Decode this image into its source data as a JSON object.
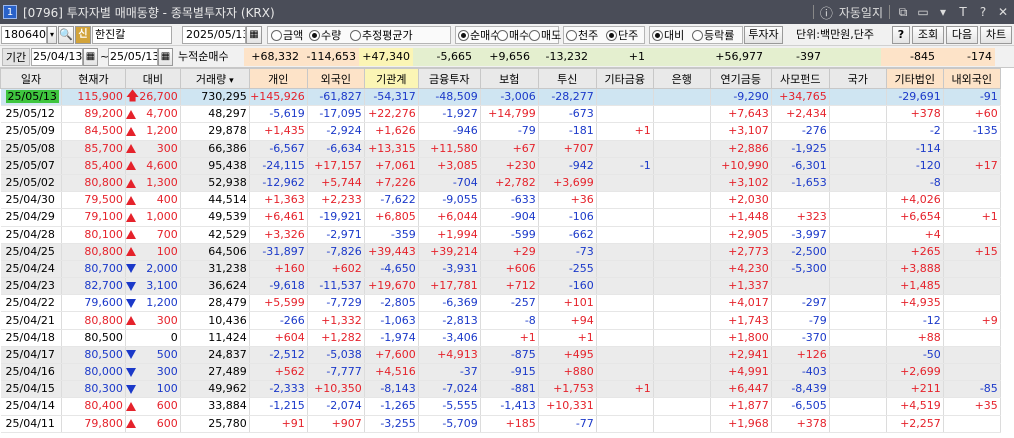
{
  "window": {
    "badge": "1",
    "screen_no": "[0796]",
    "title": "투자자별 매매동향 - 종목별투자자 (KRX)",
    "auto_lock": "자동일지",
    "icons": [
      "pin-icon",
      "layout-icon",
      "text-icon",
      "text-small-icon",
      "question-icon",
      "close-icon"
    ]
  },
  "toolbar": {
    "code": "180640",
    "stock_badge": "신",
    "stock_name": "한진칼",
    "date": "2025/05/13",
    "amount_opts": [
      {
        "label": "금액",
        "on": false
      },
      {
        "label": "수량",
        "on": true
      },
      {
        "label": "추정평균가",
        "on": false
      }
    ],
    "trade_opts": [
      {
        "label": "순매수",
        "on": true
      },
      {
        "label": "매수",
        "on": false
      },
      {
        "label": "매도",
        "on": false
      }
    ],
    "unit_opts": [
      {
        "label": "천주",
        "on": false
      },
      {
        "label": "단주",
        "on": true
      }
    ],
    "compare_opts": [
      {
        "label": "대비",
        "on": true
      },
      {
        "label": "등락률",
        "on": false
      }
    ],
    "investor_btn": "투자자",
    "unit_text": "단위:백만원,단주",
    "help_btn": "?",
    "query_btn": "조회",
    "next_btn": "다음",
    "chart_btn": "차트"
  },
  "period": {
    "label": "기간",
    "from": "25/04/13",
    "sep": "~",
    "to": "25/05/13",
    "cum_label": "누적순매수"
  },
  "sums": {
    "개인": "+68,332",
    "외국인": "-114,653",
    "기관계": "+47,340",
    "금융투자": "-5,665",
    "보험": "+9,656",
    "투신": "-13,232",
    "기타금융": "+1",
    "은행": "",
    "연기금등": "+56,977",
    "사모펀드": "-397",
    "국가": "",
    "기타법인": "-845",
    "내외국인": "-174"
  },
  "columns": [
    "일자",
    "현재가",
    "대비",
    "거래량",
    "개인",
    "외국인",
    "기관계",
    "금융투자",
    "보험",
    "투신",
    "기타금융",
    "은행",
    "연기금등",
    "사모펀드",
    "국가",
    "기타법인",
    "내외국인"
  ],
  "rows": [
    {
      "date": "25/05/13",
      "price": "115,900",
      "dir": "limitup",
      "chg": "26,700",
      "vol": "730,295",
      "ind": "+145,926",
      "for": "-61,827",
      "inst": "-54,317",
      "fin": "-48,509",
      "ins": "-3,006",
      "trust": "-28,277",
      "oth": "",
      "bank": "",
      "pen": "-9,290",
      "pe": "+34,765",
      "gov": "",
      "corp": "-29,691",
      "frn": "-91"
    },
    {
      "date": "25/05/12",
      "price": "89,200",
      "dir": "up",
      "chg": "4,700",
      "vol": "48,297",
      "ind": "-5,619",
      "for": "-17,095",
      "inst": "+22,276",
      "fin": "-1,927",
      "ins": "+14,799",
      "trust": "-673",
      "oth": "",
      "bank": "",
      "pen": "+7,643",
      "pe": "+2,434",
      "gov": "",
      "corp": "+378",
      "frn": "+60"
    },
    {
      "date": "25/05/09",
      "price": "84,500",
      "dir": "up",
      "chg": "1,200",
      "vol": "29,878",
      "ind": "+1,435",
      "for": "-2,924",
      "inst": "+1,626",
      "fin": "-946",
      "ins": "-79",
      "trust": "-181",
      "oth": "+1",
      "bank": "",
      "pen": "+3,107",
      "pe": "-276",
      "gov": "",
      "corp": "-2",
      "frn": "-135"
    },
    {
      "date": "25/05/08",
      "price": "85,700",
      "dir": "up",
      "chg": "300",
      "vol": "66,386",
      "ind": "-6,567",
      "for": "-6,634",
      "inst": "+13,315",
      "fin": "+11,580",
      "ins": "+67",
      "trust": "+707",
      "oth": "",
      "bank": "",
      "pen": "+2,886",
      "pe": "-1,925",
      "gov": "",
      "corp": "-114",
      "frn": ""
    },
    {
      "date": "25/05/07",
      "price": "85,400",
      "dir": "up",
      "chg": "4,600",
      "vol": "95,438",
      "ind": "-24,115",
      "for": "+17,157",
      "inst": "+7,061",
      "fin": "+3,085",
      "ins": "+230",
      "trust": "-942",
      "oth": "-1",
      "bank": "",
      "pen": "+10,990",
      "pe": "-6,301",
      "gov": "",
      "corp": "-120",
      "frn": "+17"
    },
    {
      "date": "25/05/02",
      "price": "80,800",
      "dir": "up",
      "chg": "1,300",
      "vol": "52,938",
      "ind": "-12,962",
      "for": "+5,744",
      "inst": "+7,226",
      "fin": "-704",
      "ins": "+2,782",
      "trust": "+3,699",
      "oth": "",
      "bank": "",
      "pen": "+3,102",
      "pe": "-1,653",
      "gov": "",
      "corp": "-8",
      "frn": ""
    },
    {
      "date": "25/04/30",
      "price": "79,500",
      "dir": "up",
      "chg": "400",
      "vol": "44,514",
      "ind": "+1,363",
      "for": "+2,233",
      "inst": "-7,622",
      "fin": "-9,055",
      "ins": "-633",
      "trust": "+36",
      "oth": "",
      "bank": "",
      "pen": "+2,030",
      "pe": "",
      "gov": "",
      "corp": "+4,026",
      "frn": ""
    },
    {
      "date": "25/04/29",
      "price": "79,100",
      "dir": "up",
      "chg": "1,000",
      "vol": "49,539",
      "ind": "+6,461",
      "for": "-19,921",
      "inst": "+6,805",
      "fin": "+6,044",
      "ins": "-904",
      "trust": "-106",
      "oth": "",
      "bank": "",
      "pen": "+1,448",
      "pe": "+323",
      "gov": "",
      "corp": "+6,654",
      "frn": "+1"
    },
    {
      "date": "25/04/28",
      "price": "80,100",
      "dir": "up",
      "chg": "700",
      "vol": "42,529",
      "ind": "+3,326",
      "for": "-2,971",
      "inst": "-359",
      "fin": "+1,994",
      "ins": "-599",
      "trust": "-662",
      "oth": "",
      "bank": "",
      "pen": "+2,905",
      "pe": "-3,997",
      "gov": "",
      "corp": "+4",
      "frn": ""
    },
    {
      "date": "25/04/25",
      "price": "80,800",
      "dir": "up",
      "chg": "100",
      "vol": "64,506",
      "ind": "-31,897",
      "for": "-7,826",
      "inst": "+39,443",
      "fin": "+39,214",
      "ins": "+29",
      "trust": "-73",
      "oth": "",
      "bank": "",
      "pen": "+2,773",
      "pe": "-2,500",
      "gov": "",
      "corp": "+265",
      "frn": "+15"
    },
    {
      "date": "25/04/24",
      "price": "80,700",
      "dir": "dn",
      "chg": "2,000",
      "vol": "31,238",
      "ind": "+160",
      "for": "+602",
      "inst": "-4,650",
      "fin": "-3,931",
      "ins": "+606",
      "trust": "-255",
      "oth": "",
      "bank": "",
      "pen": "+4,230",
      "pe": "-5,300",
      "gov": "",
      "corp": "+3,888",
      "frn": ""
    },
    {
      "date": "25/04/23",
      "price": "82,700",
      "dir": "dn",
      "chg": "3,100",
      "vol": "36,624",
      "ind": "-9,618",
      "for": "-11,537",
      "inst": "+19,670",
      "fin": "+17,781",
      "ins": "+712",
      "trust": "-160",
      "oth": "",
      "bank": "",
      "pen": "+1,337",
      "pe": "",
      "gov": "",
      "corp": "+1,485",
      "frn": ""
    },
    {
      "date": "25/04/22",
      "price": "79,600",
      "dir": "dn",
      "chg": "1,200",
      "vol": "28,479",
      "ind": "+5,599",
      "for": "-7,729",
      "inst": "-2,805",
      "fin": "-6,369",
      "ins": "-257",
      "trust": "+101",
      "oth": "",
      "bank": "",
      "pen": "+4,017",
      "pe": "-297",
      "gov": "",
      "corp": "+4,935",
      "frn": ""
    },
    {
      "date": "25/04/21",
      "price": "80,800",
      "dir": "up",
      "chg": "300",
      "vol": "10,436",
      "ind": "-266",
      "for": "+1,332",
      "inst": "-1,063",
      "fin": "-2,813",
      "ins": "-8",
      "trust": "+94",
      "oth": "",
      "bank": "",
      "pen": "+1,743",
      "pe": "-79",
      "gov": "",
      "corp": "-12",
      "frn": "+9"
    },
    {
      "date": "25/04/18",
      "price": "80,500",
      "dir": "none",
      "chg": "0",
      "vol": "11,424",
      "ind": "+604",
      "for": "+1,282",
      "inst": "-1,974",
      "fin": "-3,406",
      "ins": "+1",
      "trust": "+1",
      "oth": "",
      "bank": "",
      "pen": "+1,800",
      "pe": "-370",
      "gov": "",
      "corp": "+88",
      "frn": ""
    },
    {
      "date": "25/04/17",
      "price": "80,500",
      "dir": "dn",
      "chg": "500",
      "vol": "24,837",
      "ind": "-2,512",
      "for": "-5,038",
      "inst": "+7,600",
      "fin": "+4,913",
      "ins": "-875",
      "trust": "+495",
      "oth": "",
      "bank": "",
      "pen": "+2,941",
      "pe": "+126",
      "gov": "",
      "corp": "-50",
      "frn": ""
    },
    {
      "date": "25/04/16",
      "price": "80,000",
      "dir": "dn",
      "chg": "300",
      "vol": "27,489",
      "ind": "+562",
      "for": "-7,777",
      "inst": "+4,516",
      "fin": "-37",
      "ins": "-915",
      "trust": "+880",
      "oth": "",
      "bank": "",
      "pen": "+4,991",
      "pe": "-403",
      "gov": "",
      "corp": "+2,699",
      "frn": ""
    },
    {
      "date": "25/04/15",
      "price": "80,300",
      "dir": "dn",
      "chg": "100",
      "vol": "49,962",
      "ind": "-2,333",
      "for": "+10,350",
      "inst": "-8,143",
      "fin": "-7,024",
      "ins": "-881",
      "trust": "+1,753",
      "oth": "+1",
      "bank": "",
      "pen": "+6,447",
      "pe": "-8,439",
      "gov": "",
      "corp": "+211",
      "frn": "-85"
    },
    {
      "date": "25/04/14",
      "price": "80,400",
      "dir": "up",
      "chg": "600",
      "vol": "33,884",
      "ind": "-1,215",
      "for": "-2,074",
      "inst": "-1,265",
      "fin": "-5,555",
      "ins": "-1,413",
      "trust": "+10,331",
      "oth": "",
      "bank": "",
      "pen": "+1,877",
      "pe": "-6,505",
      "gov": "",
      "corp": "+4,519",
      "frn": "+35"
    },
    {
      "date": "25/04/11",
      "price": "79,800",
      "dir": "up",
      "chg": "600",
      "vol": "25,780",
      "ind": "+91",
      "for": "+907",
      "inst": "-3,255",
      "fin": "-5,709",
      "ins": "+185",
      "trust": "-77",
      "oth": "",
      "bank": "",
      "pen": "+1,968",
      "pe": "+378",
      "gov": "",
      "corp": "+2,257",
      "frn": ""
    }
  ],
  "colors": {
    "up": "#e5222b",
    "down": "#1b39c9",
    "selected_row": "#cfe5f2",
    "today_badge": "#3ec53e",
    "titlebar": "#4a4d58"
  }
}
